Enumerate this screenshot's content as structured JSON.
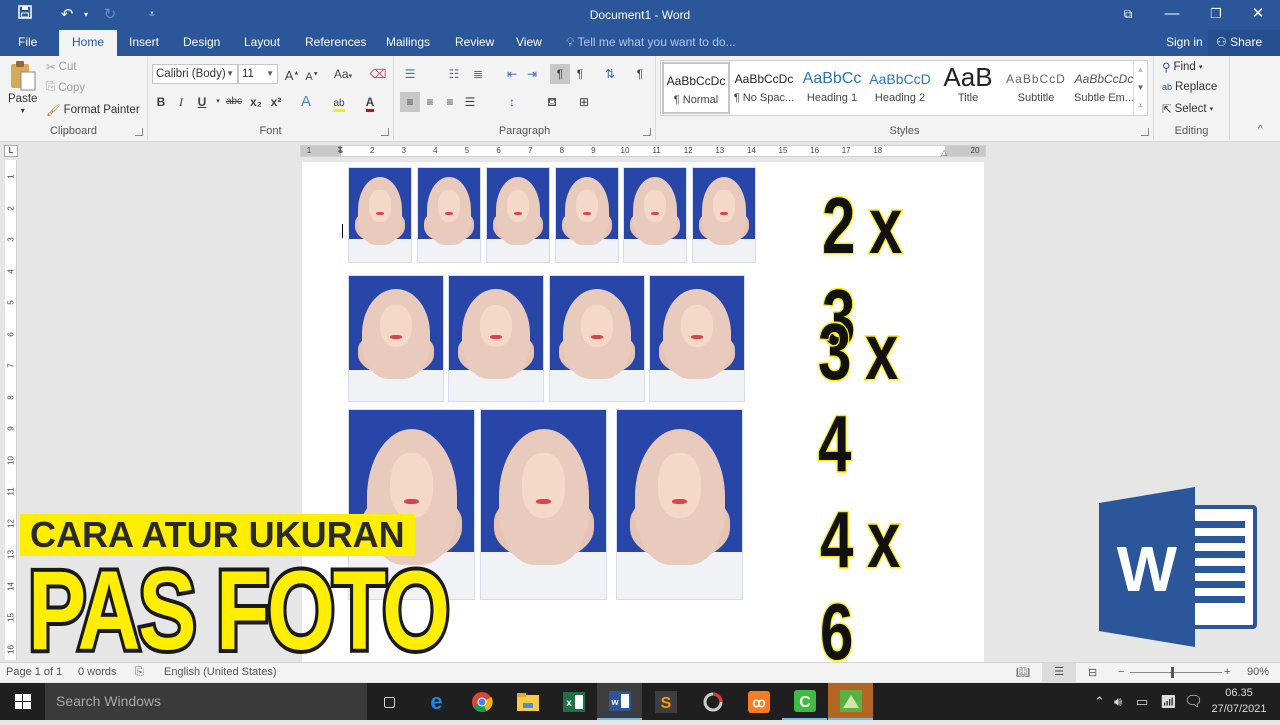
{
  "window": {
    "title": "Document1 - Word",
    "qat": {
      "save": "save-icon",
      "undo": "undo-icon",
      "redo": "redo-icon",
      "customize": "customize-qat-icon"
    },
    "controls": {
      "ribbon_display": "ribbon-display-icon",
      "minimize": "minimize-icon",
      "restore": "restore-icon",
      "close": "close-icon"
    }
  },
  "tabs": [
    {
      "label": "File"
    },
    {
      "label": "Home",
      "active": true
    },
    {
      "label": "Insert"
    },
    {
      "label": "Design"
    },
    {
      "label": "Layout"
    },
    {
      "label": "References"
    },
    {
      "label": "Mailings"
    },
    {
      "label": "Review"
    },
    {
      "label": "View"
    }
  ],
  "tell_me": "Tell me what you want to do...",
  "sign_in": "Sign in",
  "share": "Share",
  "ribbon": {
    "clipboard": {
      "label": "Clipboard",
      "paste": "Paste",
      "cut": "Cut",
      "copy": "Copy",
      "format_painter": "Format Painter"
    },
    "font": {
      "label": "Font",
      "font_name": "Calibri (Body)",
      "font_size": "11",
      "change_case": "Aa",
      "bold": "B",
      "italic": "I",
      "underline": "U",
      "strikethrough": "abc",
      "subscript": "x₂",
      "superscript": "x²"
    },
    "paragraph": {
      "label": "Paragraph"
    },
    "styles": {
      "label": "Styles",
      "items": [
        {
          "preview": "AaBbCcDc",
          "name": "¶ Normal",
          "selected": true
        },
        {
          "preview": "AaBbCcDc",
          "name": "¶ No Spac..."
        },
        {
          "preview": "AaBbCc",
          "name": "Heading 1"
        },
        {
          "preview": "AaBbCcD",
          "name": "Heading 2"
        },
        {
          "preview": "AaB",
          "name": "Title"
        },
        {
          "preview": "AaBbCcD",
          "name": "Subtitle"
        },
        {
          "preview": "AaBbCcDc",
          "name": "Subtle Em..."
        }
      ]
    },
    "editing": {
      "label": "Editing",
      "find": "Find",
      "replace": "Replace",
      "select": "Select"
    }
  },
  "ruler": {
    "horizontal": [
      "1",
      "1",
      "2",
      "3",
      "4",
      "5",
      "6",
      "7",
      "8",
      "9",
      "10",
      "11",
      "12",
      "13",
      "14",
      "15",
      "16",
      "17",
      "18",
      "20"
    ],
    "vertical": [
      "1",
      "2",
      "3",
      "4",
      "5",
      "6",
      "7",
      "8",
      "9",
      "10",
      "11",
      "12",
      "13",
      "14",
      "15",
      "16"
    ]
  },
  "document": {
    "rows": [
      {
        "size_label": "2 x 3",
        "photo_count": 6
      },
      {
        "size_label": "3 x 4",
        "photo_count": 4
      },
      {
        "size_label": "4 x 6",
        "photo_count": 3
      }
    ]
  },
  "overlay": {
    "subtitle": "CARA ATUR UKURAN",
    "title": "PAS FOTO",
    "logo": "W"
  },
  "statusbar": {
    "page": "Page 1 of 1",
    "words": "0 words",
    "language": "English (United States)",
    "zoom": "90%",
    "zoom_percent": 90
  },
  "taskbar": {
    "search_placeholder": "Search Windows",
    "apps": [
      "task-view",
      "edge",
      "chrome",
      "file-explorer",
      "excel",
      "word",
      "sublime-text",
      "davinci-resolve",
      "xampp",
      "camtasia",
      "coreldraw"
    ],
    "time": "06.35",
    "date": "27/07/2021"
  }
}
